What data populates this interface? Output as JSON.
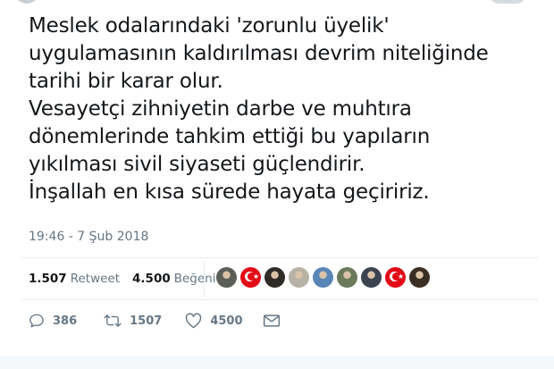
{
  "tweet": {
    "lines": [
      "Meslek odalarındaki 'zorunlu üyelik'",
      "uygulamasının kaldırılması devrim niteliğinde",
      "tarihi bir karar olur.",
      "Vesayetçi zihniyetin darbe ve muhtıra",
      "dönemlerinde tahkim ettiği bu yapıların",
      "yıkılması sivil siyaseti güçlendirir.",
      "İnşallah en kısa sürede hayata geçiririz."
    ],
    "timestamp": "19:46 - 7 Şub 2018"
  },
  "stats": {
    "retweet_count": "1.507",
    "retweet_label": "Retweet",
    "like_count": "4.500",
    "like_label": "Beğeni"
  },
  "liker_avatars": [
    {
      "icon": "person-avatar",
      "color": "#5b5e57"
    },
    {
      "icon": "turkish-flag-avatar",
      "color": "#e30a17"
    },
    {
      "icon": "person-avatar",
      "color": "#2f2b27"
    },
    {
      "icon": "person-avatar",
      "color": "#b8b2a6"
    },
    {
      "icon": "building-avatar",
      "color": "#5a86b7"
    },
    {
      "icon": "person-avatar",
      "color": "#6a7a5a"
    },
    {
      "icon": "person-avatar",
      "color": "#3b4350"
    },
    {
      "icon": "turkish-flag-avatar",
      "color": "#e30a17"
    },
    {
      "icon": "person-avatar",
      "color": "#3a2e22"
    }
  ],
  "actions": {
    "reply_count": "386",
    "retweet_count": "1507",
    "like_count": "4500"
  },
  "colors": {
    "text": "#14171a",
    "secondary": "#657786",
    "divider": "#e6ecf0",
    "flag_red": "#e30a17"
  }
}
